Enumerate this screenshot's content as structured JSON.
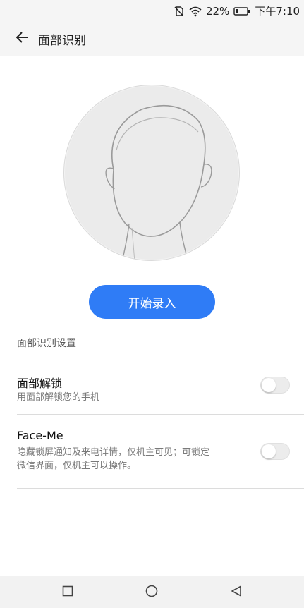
{
  "status_bar": {
    "battery_percent": "22%",
    "time": "下午7:10",
    "icons": [
      "no-sim-icon",
      "wifi-icon",
      "battery-icon"
    ]
  },
  "app_bar": {
    "title": "面部识别",
    "back_icon": "arrow-left-icon"
  },
  "illustration": {
    "icon": "face-outline-icon"
  },
  "start_button": {
    "label": "开始录入",
    "color": "#2f7cf6"
  },
  "settings": {
    "section_title": "面部识别设置",
    "items": [
      {
        "title": "面部解锁",
        "description": "用面部解锁您的手机",
        "enabled": false
      },
      {
        "title": "Face-Me",
        "description_line1": "隐藏锁屏通知及来电详情，仅机主可见；可锁定",
        "description_line2": "微信界面，仅机主可以操作。",
        "enabled": false
      }
    ]
  },
  "nav_bar": {
    "icons": [
      "recent-apps-icon",
      "home-icon",
      "back-triangle-icon"
    ]
  }
}
